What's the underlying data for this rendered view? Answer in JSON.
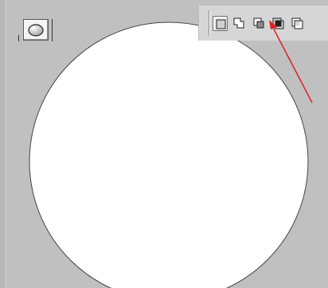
{
  "colors": {
    "background": "#c0c0c0",
    "toolbar_bg": "#d6d6d6",
    "circle_fill": "#ffffff",
    "circle_stroke": "#444444",
    "annotation_arrow": "#e02020"
  },
  "shape_tool": {
    "icon": "ellipse-shape-icon"
  },
  "mode_toolbar": {
    "buttons": [
      {
        "icon": "new-shape-layer-icon",
        "active": true
      },
      {
        "icon": "add-to-shape-area-icon",
        "active": false
      },
      {
        "icon": "subtract-from-shape-area-icon",
        "active": false
      },
      {
        "icon": "intersect-shape-areas-icon",
        "active": false
      },
      {
        "icon": "exclude-overlapping-shape-areas-icon",
        "active": false
      }
    ]
  },
  "annotation": {
    "type": "arrow",
    "target": "subtract-from-shape-area-button"
  }
}
